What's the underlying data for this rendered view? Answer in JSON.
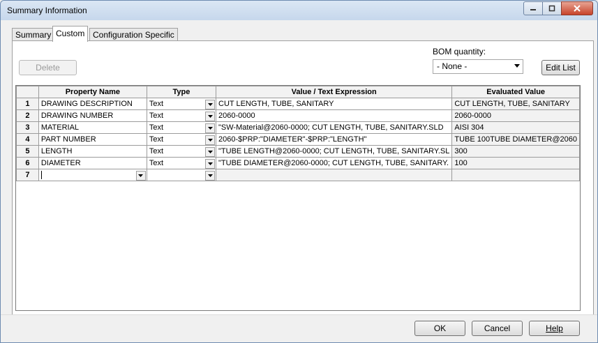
{
  "window": {
    "title": "Summary Information"
  },
  "tabs": [
    {
      "label": "Summary"
    },
    {
      "label": "Custom"
    },
    {
      "label": "Configuration Specific"
    }
  ],
  "toolbar": {
    "delete_label": "Delete",
    "bom_label": "BOM quantity:",
    "bom_value": "- None -",
    "edit_list_label": "Edit List"
  },
  "table": {
    "headers": [
      "Property Name",
      "Type",
      "Value / Text Expression",
      "Evaluated Value"
    ],
    "rows": [
      {
        "num": "1",
        "name": "DRAWING DESCRIPTION",
        "type": "Text",
        "value": "CUT LENGTH, TUBE, SANITARY",
        "evaluated": "CUT LENGTH, TUBE, SANITARY"
      },
      {
        "num": "2",
        "name": "DRAWING NUMBER",
        "type": "Text",
        "value": "2060-0000",
        "evaluated": "2060-0000"
      },
      {
        "num": "3",
        "name": "MATERIAL",
        "type": "Text",
        "value": "\"SW-Material@2060-0000; CUT LENGTH, TUBE, SANITARY.SLD",
        "evaluated": "AISI 304"
      },
      {
        "num": "4",
        "name": "PART NUMBER",
        "type": "Text",
        "value": "2060-$PRP:\"DIAMETER\"-$PRP:\"LENGTH\"",
        "evaluated": "TUBE 100TUBE DIAMETER@2060"
      },
      {
        "num": "5",
        "name": "LENGTH",
        "type": "Text",
        "value": "\"TUBE LENGTH@2060-0000; CUT LENGTH, TUBE, SANITARY.SL",
        "evaluated": "300"
      },
      {
        "num": "6",
        "name": "DIAMETER",
        "type": "Text",
        "value": "\"TUBE DIAMETER@2060-0000; CUT LENGTH, TUBE, SANITARY.",
        "evaluated": "100"
      }
    ],
    "new_row_num": "7"
  },
  "footer": {
    "ok_label": "OK",
    "cancel_label": "Cancel",
    "help_label": "Help"
  },
  "icons": {
    "minimize": "minimize-icon",
    "maximize": "maximize-icon",
    "close": "close-icon",
    "dropdown": "chevron-down-icon"
  }
}
